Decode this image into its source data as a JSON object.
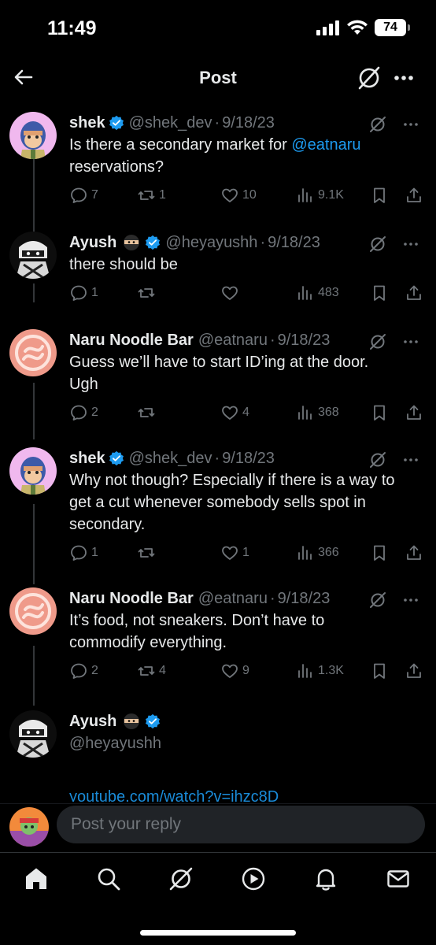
{
  "status_bar": {
    "time": "11:49",
    "battery": "74"
  },
  "header": {
    "title": "Post"
  },
  "tweets": [
    {
      "name": "shek",
      "handle": "@shek_dev",
      "dot": "·",
      "date": "9/18/23",
      "text_lines": [
        "Is there a secondary market for ",
        "@eatnaru",
        "reservations?"
      ],
      "replies": "7",
      "reposts": "1",
      "likes": "10",
      "views": "9.1K"
    },
    {
      "name": "Ayush",
      "handle": "@heyayushh",
      "dot": "·",
      "date": "9/18/23",
      "text_lines": [
        "there should be"
      ],
      "replies": "1",
      "reposts": "",
      "likes": "",
      "views": "483"
    },
    {
      "name": "Naru Noodle Bar",
      "handle": "@eatnaru",
      "dot": "·",
      "date": "9/18/23",
      "text_lines": [
        "Guess we’ll have to start ID’ing at the door.",
        "Ugh"
      ],
      "replies": "2",
      "reposts": "",
      "likes": "4",
      "views": "368"
    },
    {
      "name": "shek",
      "handle": "@shek_dev",
      "dot": "·",
      "date": "9/18/23",
      "text_lines": [
        "Why not though? Especially if there is a way to",
        "get a cut whenever somebody sells spot in",
        "secondary."
      ],
      "replies": "1",
      "reposts": "",
      "likes": "1",
      "views": "366"
    },
    {
      "name": "Naru Noodle Bar",
      "handle": "@eatnaru",
      "dot": "·",
      "date": "9/18/23",
      "text_lines": [
        "It’s food, not sneakers. Don’t have to",
        "commodify everything."
      ],
      "replies": "2",
      "reposts": "4",
      "likes": "9",
      "views": "1.3K"
    },
    {
      "name": "Ayush",
      "handle": "@heyayushh"
    }
  ],
  "link_peek": "youtube.com/watch?v=ihzc8D",
  "reply": {
    "placeholder": "Post your reply"
  },
  "tabbar": [
    "home-icon",
    "search-icon",
    "grok-icon",
    "video-icon",
    "notifications-icon",
    "messages-icon"
  ],
  "colors": {
    "background": "#000000",
    "text": "#e7e9ea",
    "muted": "#71767b",
    "accent": "#1d9bf0",
    "verified": "#1d9bf0"
  }
}
